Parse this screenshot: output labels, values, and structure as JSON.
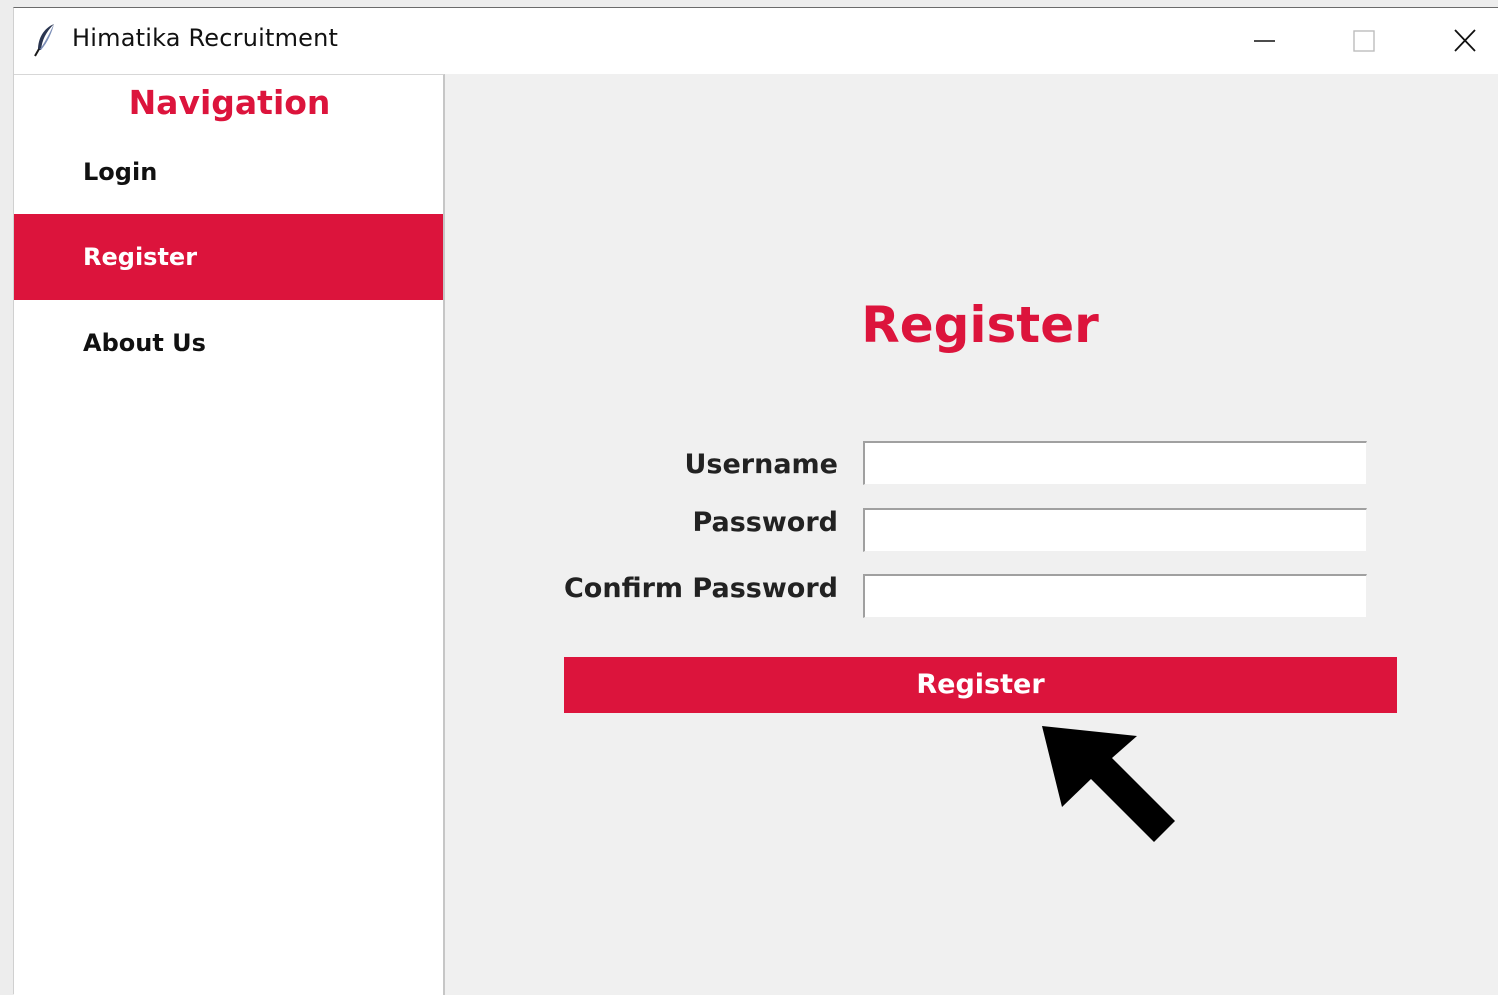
{
  "window": {
    "title": "Himatika Recruitment",
    "icon": "feather-icon",
    "controls": [
      "minimize-icon",
      "maximize-icon",
      "close-icon"
    ]
  },
  "sidebar": {
    "heading": "Navigation",
    "items": [
      {
        "label": "Login",
        "active": false
      },
      {
        "label": "Register",
        "active": true
      },
      {
        "label": "About Us",
        "active": false
      }
    ]
  },
  "main": {
    "title": "Register",
    "fields": [
      {
        "label": "Username",
        "value": ""
      },
      {
        "label": "Password",
        "value": ""
      },
      {
        "label": "Confirm Password",
        "value": ""
      }
    ],
    "submit_label": "Register"
  },
  "overlay": {
    "icon": "arrow-pointer-icon"
  },
  "colors": {
    "accent": "#dc143c",
    "background": "#f0f0f0",
    "sidebar_bg": "#ffffff"
  }
}
